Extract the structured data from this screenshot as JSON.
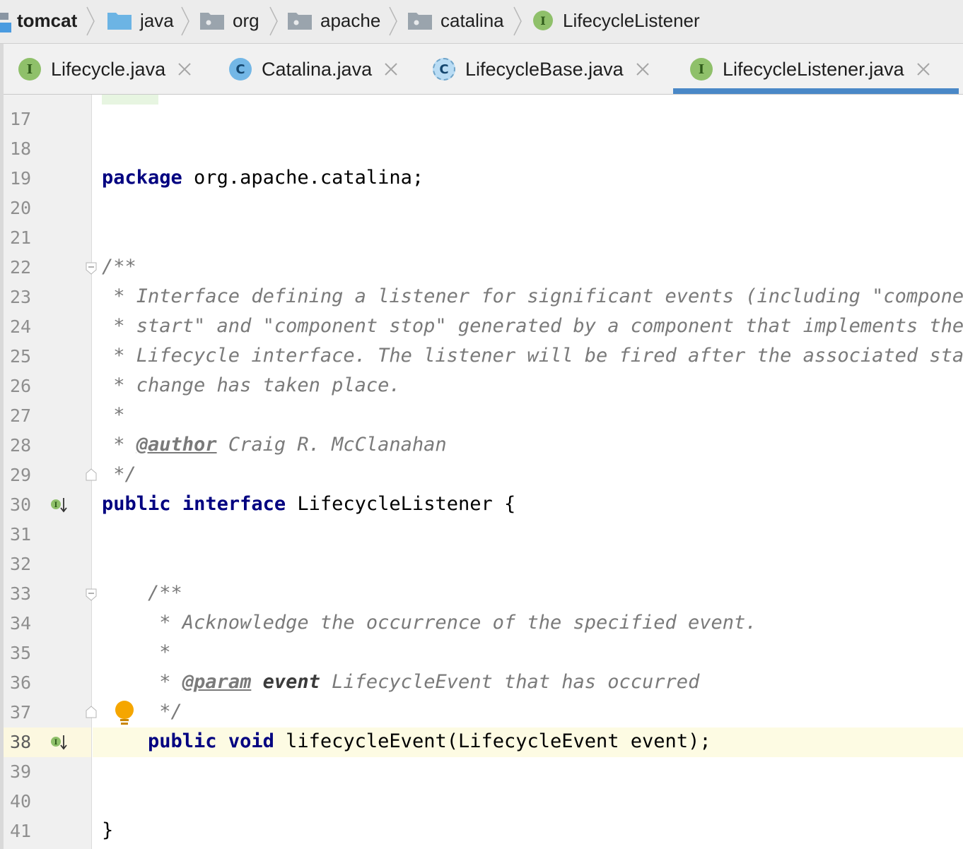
{
  "breadcrumb": {
    "items": [
      {
        "label": "tomcat",
        "icon": "module-icon"
      },
      {
        "label": "java",
        "icon": "source-folder-icon"
      },
      {
        "label": "org",
        "icon": "package-folder-icon"
      },
      {
        "label": "apache",
        "icon": "package-folder-icon"
      },
      {
        "label": "catalina",
        "icon": "package-folder-icon"
      },
      {
        "label": "LifecycleListener",
        "icon": "interface-icon",
        "badge": "I"
      }
    ]
  },
  "tabs": [
    {
      "label": "Lifecycle.java",
      "badge": "I",
      "kind": "interface"
    },
    {
      "label": "Catalina.java",
      "badge": "C",
      "kind": "class"
    },
    {
      "label": "LifecycleBase.java",
      "badge": "C",
      "kind": "abstract-class"
    },
    {
      "label": "LifecycleListener.java",
      "badge": "I",
      "kind": "interface",
      "active": true
    }
  ],
  "editor": {
    "line_numbers": [
      "17",
      "18",
      "19",
      "20",
      "21",
      "22",
      "23",
      "24",
      "25",
      "26",
      "27",
      "28",
      "29",
      "30",
      "31",
      "32",
      "33",
      "34",
      "35",
      "36",
      "37",
      "38",
      "39",
      "40",
      "41"
    ],
    "current_line": "38",
    "code": {
      "l19_kw": "package",
      "l19_rest": " org.apache.catalina;",
      "l22": "/**",
      "l23": " * Interface defining a listener for significant events (including \"componen",
      "l24": " * start\" and \"component stop\" generated by a component that implements the",
      "l25": " * Lifecycle interface. The listener will be fired after the associated stat",
      "l26": " * change has taken place.",
      "l27": " *",
      "l28_star": " * ",
      "l28_tag": "@author",
      "l28_rest": " Craig R. McClanahan",
      "l29": " */",
      "l30_kw1": "public",
      "l30_kw2": "interface",
      "l30_rest": " LifecycleListener {",
      "l33": "    /**",
      "l34": "     * Acknowledge the occurrence of the specified event.",
      "l35": "     *",
      "l36_star": "     * ",
      "l36_tag": "@param",
      "l36_param": "event",
      "l36_rest": " LifecycleEvent that has occurred",
      "l37": "     */",
      "l38_indent": "    ",
      "l38_kw1": "public",
      "l38_kw2": "void",
      "l38_rest": " lifecycleEvent(LifecycleEvent event);",
      "l41": "}"
    }
  },
  "colors": {
    "keyword": "#000080",
    "doc_comment": "#7a7a7a",
    "interface_badge": "#8fc06a",
    "class_badge": "#73b7e6",
    "active_tab_underline": "#4a88c7",
    "current_line": "#fdfbe3"
  }
}
